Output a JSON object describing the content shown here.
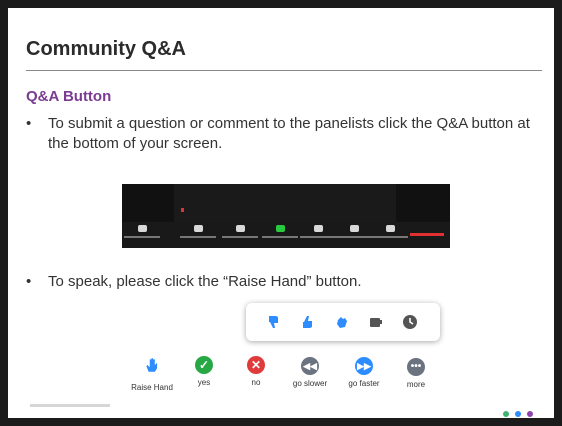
{
  "slide": {
    "title": "Community Q&A",
    "subheading": "Q&A Button",
    "bullets": [
      "To submit a question or comment to the panelists click the Q&A button at the bottom of your screen.",
      "To speak, please click the “Raise Hand” button."
    ],
    "bullet_symbol": "•"
  },
  "reactions": [
    {
      "label": "Raise Hand",
      "icon": "hand-icon",
      "color": "#2d8cff"
    },
    {
      "label": "yes",
      "icon": "check-icon",
      "color": "#27a844"
    },
    {
      "label": "no",
      "icon": "x-icon",
      "color": "#e03b3b"
    },
    {
      "label": "go slower",
      "icon": "rewind-icon",
      "color": "#6b7280"
    },
    {
      "label": "go faster",
      "icon": "fast-forward-icon",
      "color": "#2d8cff"
    },
    {
      "label": "more",
      "icon": "more-icon",
      "color": "#6b7280"
    }
  ],
  "popup_icons": [
    "thumbs-down-icon",
    "thumbs-up-icon",
    "clap-icon",
    "coffee-icon",
    "clock-icon"
  ],
  "colors": {
    "title": "#2b2b2b",
    "subheading": "#7a3b91",
    "accent_blue": "#2d8cff",
    "dot_colors": [
      "#3cb371",
      "#2d8cff",
      "#8e44ad"
    ]
  }
}
